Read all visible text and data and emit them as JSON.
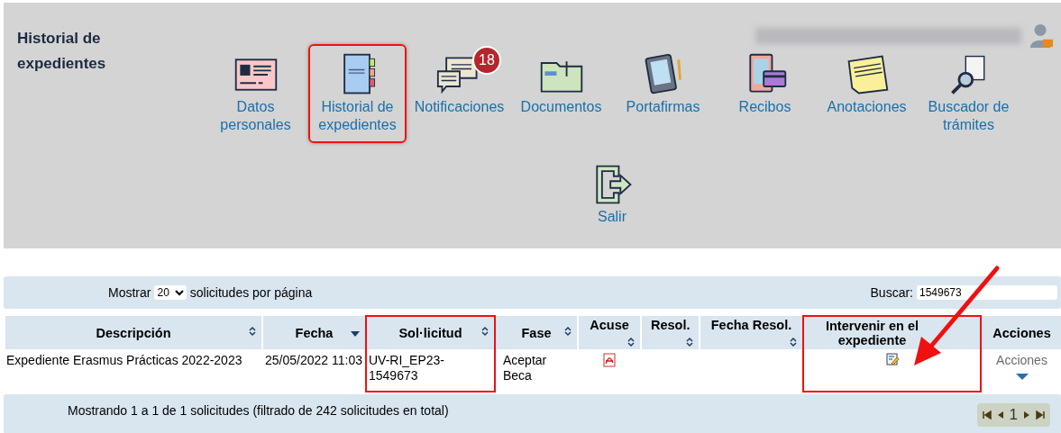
{
  "header": {
    "title": "Historial de expedientes",
    "menu_rows": [
      {
        "items": [
          {
            "label": "Datos personales",
            "highlighted": false
          },
          {
            "label": "Historial de expedientes",
            "highlighted": true
          },
          {
            "label": "Notificaciones",
            "highlighted": false,
            "badge": "18"
          },
          {
            "label": "Documentos",
            "highlighted": false
          },
          {
            "label": "Portafirmas",
            "highlighted": false
          },
          {
            "label": "Recibos",
            "highlighted": false
          },
          {
            "label": "Anotaciones",
            "highlighted": false
          },
          {
            "label": "Buscador de trámites",
            "highlighted": false
          }
        ]
      },
      {
        "items": [
          {
            "label": "Salir",
            "highlighted": false
          }
        ]
      }
    ]
  },
  "toolbar": {
    "show_before": "Mostrar",
    "page_size": "20",
    "show_after": "solicitudes por página",
    "search_label": "Buscar:",
    "search_value": "1549673"
  },
  "table": {
    "columns": [
      {
        "label": "Descripción",
        "sortable": true,
        "sorted_desc": false,
        "highlighted": false
      },
      {
        "label": "Fecha",
        "sortable": true,
        "sorted_desc": true,
        "highlighted": false
      },
      {
        "label": "Sol·licitud",
        "sortable": true,
        "sorted_desc": false,
        "highlighted": true
      },
      {
        "label": "Fase",
        "sortable": true,
        "sorted_desc": false,
        "highlighted": false
      },
      {
        "label": "Acuse",
        "sortable": true,
        "sorted_desc": false,
        "highlighted": false
      },
      {
        "label": "Resol.",
        "sortable": true,
        "sorted_desc": false,
        "highlighted": false
      },
      {
        "label": "Fecha Resol.",
        "sortable": true,
        "sorted_desc": false,
        "highlighted": false
      },
      {
        "label": "Intervenir en el expediente",
        "sortable": false,
        "highlighted": true
      },
      {
        "label": "Acciones",
        "sortable": false,
        "highlighted": false
      }
    ],
    "rows": [
      {
        "descripcion": "Expediente Erasmus Prácticas 2022-2023",
        "fecha": "25/05/2022 11:03",
        "solicitud": "UV-RI_EP23-1549673",
        "fase": "Aceptar Beca",
        "acciones": "Acciones"
      }
    ]
  },
  "footer": {
    "info": "Mostrando 1 a 1 de 1 solicitudes (filtrado de 242 solicitudes en total)",
    "page": "1"
  }
}
